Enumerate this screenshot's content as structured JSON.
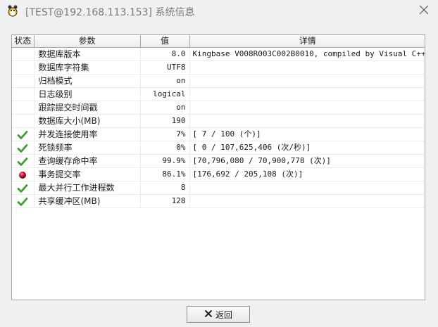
{
  "window": {
    "title": "[TEST@192.168.113.153] 系统信息"
  },
  "table": {
    "headers": {
      "status": "状态",
      "param": "参数",
      "value": "值",
      "detail": "详情"
    },
    "rows": [
      {
        "status": "",
        "param": "数据库版本",
        "value": "8.0",
        "detail": "Kingbase V008R003C002B0010, compiled by Visual C++ ..."
      },
      {
        "status": "",
        "param": "数据库字符集",
        "value": "UTF8",
        "detail": ""
      },
      {
        "status": "",
        "param": "归档模式",
        "value": "on",
        "detail": ""
      },
      {
        "status": "",
        "param": "日志级别",
        "value": "logical",
        "detail": ""
      },
      {
        "status": "",
        "param": "跟踪提交时间戳",
        "value": "on",
        "detail": ""
      },
      {
        "status": "",
        "param": "数据库大小(MB)",
        "value": "190",
        "detail": ""
      },
      {
        "status": "ok",
        "param": "并发连接使用率",
        "value": "7%",
        "detail": "[     7 /    100 (个)]"
      },
      {
        "status": "ok",
        "param": "死锁频率",
        "value": "0%",
        "detail": "[     0 / 107,625,406 (次/秒)]"
      },
      {
        "status": "ok",
        "param": "查询缓存命中率",
        "value": "99.9%",
        "detail": "[70,796,080 / 70,900,778 (次)]"
      },
      {
        "status": "error",
        "param": "事务提交率",
        "value": "86.1%",
        "detail": "[176,692 / 205,108 (次)]"
      },
      {
        "status": "ok",
        "param": "最大并行工作进程数",
        "value": "8",
        "detail": ""
      },
      {
        "status": "ok",
        "param": "共享缓冲区(MB)",
        "value": "128",
        "detail": ""
      }
    ]
  },
  "footer": {
    "back_label": "返回"
  },
  "colors": {
    "ok_check": "#3aa02a",
    "error_dot": "#c0102a"
  }
}
